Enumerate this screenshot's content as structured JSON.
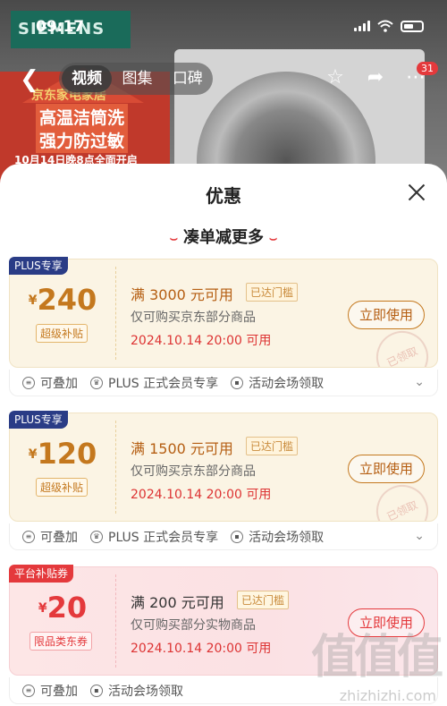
{
  "status": {
    "time": "09:17"
  },
  "background": {
    "brand": "SIEMENS",
    "promo_store": "京东家电家居",
    "headline_1": "高温洁筒洗",
    "headline_2": "强力防过敏",
    "date_banner": "10月14日晚8点全面开启"
  },
  "nav": {
    "tabs": [
      {
        "label": "视频",
        "active": true
      },
      {
        "label": "图集",
        "active": false
      },
      {
        "label": "口碑",
        "active": false
      }
    ],
    "badge": "31"
  },
  "sheet": {
    "title": "优惠",
    "subtitle": "凑单减更多"
  },
  "coupons": [
    {
      "tag": "PLUS专享",
      "currency": "¥",
      "amount": "240",
      "sub_label": "超级补贴",
      "condition": "满 3000 元可用",
      "reached": "已达门槛",
      "scope": "仅可购买京东部分商品",
      "expiry": "2024.10.14 20:00 可用",
      "button": "立即使用",
      "stamp": "已领取",
      "features": [
        "可叠加",
        "PLUS 正式会员专享",
        "活动会场领取"
      ]
    },
    {
      "tag": "PLUS专享",
      "currency": "¥",
      "amount": "120",
      "sub_label": "超级补贴",
      "condition": "满 1500 元可用",
      "reached": "已达门槛",
      "scope": "仅可购买京东部分商品",
      "expiry": "2024.10.14 20:00 可用",
      "button": "立即使用",
      "stamp": "已领取",
      "features": [
        "可叠加",
        "PLUS 正式会员专享",
        "活动会场领取"
      ]
    },
    {
      "tag": "平台补贴券",
      "currency": "¥",
      "amount": "20",
      "sub_label": "限品类东券",
      "condition": "满 200 元可用",
      "reached": "已达门槛",
      "scope": "仅可购买部分实物商品",
      "expiry": "2024.10.14 20:00 可用",
      "button": "立即使用",
      "features": [
        "可叠加",
        "活动会场领取"
      ]
    }
  ],
  "watermark": "zhizhizhi.com",
  "watermark_logo": "值值值"
}
